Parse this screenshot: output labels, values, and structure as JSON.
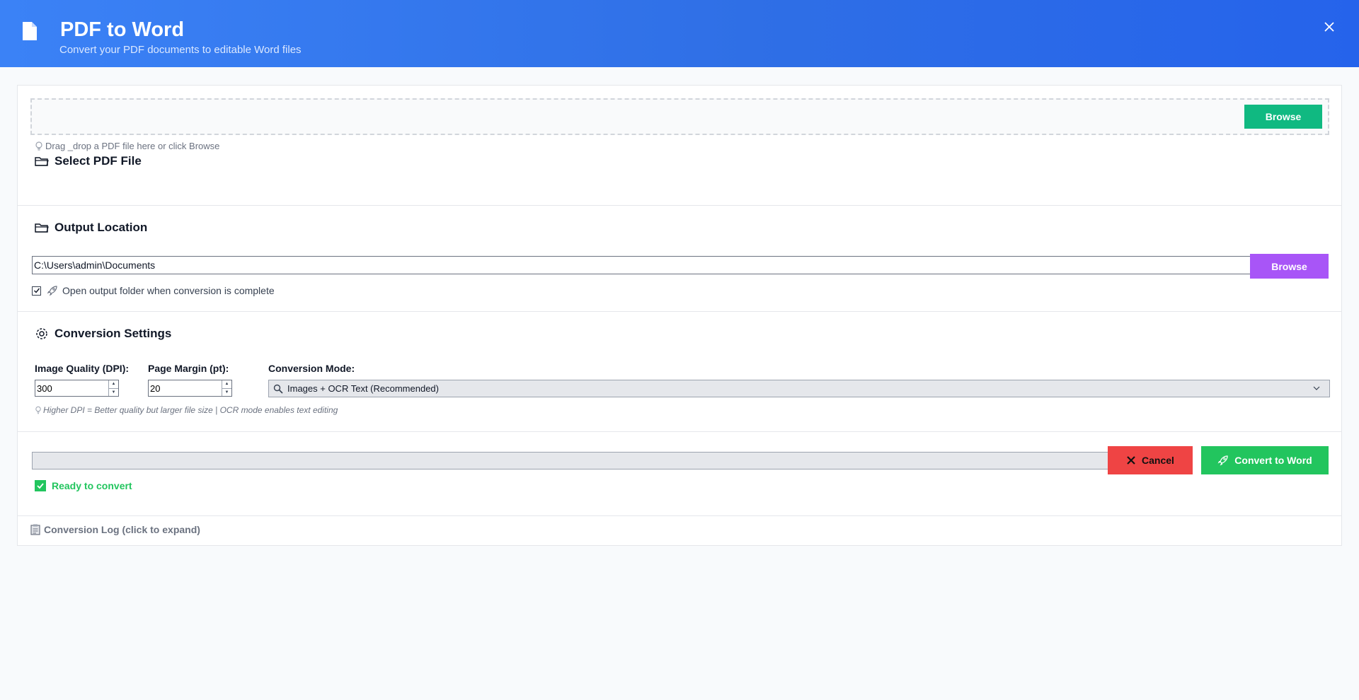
{
  "header": {
    "title": "PDF to Word",
    "subtitle": "Convert your PDF documents to editable Word files",
    "icon": "document-icon",
    "close_icon": "close-icon"
  },
  "select_pdf": {
    "title": "Select PDF File",
    "icon": "folder-icon",
    "hint": "Drag _drop a PDF file here or click Browse",
    "hint_icon": "lightbulb-icon",
    "browse_label": "Browse"
  },
  "output": {
    "title": "Output Location",
    "icon": "folder-icon",
    "path": "C:\\Users\\admin\\Documents",
    "browse_label": "Browse",
    "open_folder_label": "Open output folder when conversion is complete",
    "open_folder_checked": true,
    "open_folder_icon": "rocket-icon"
  },
  "settings": {
    "title": "Conversion Settings",
    "icon": "gear-icon",
    "dpi_label": "Image Quality (DPI):",
    "dpi_value": "300",
    "margin_label": "Page Margin (pt):",
    "margin_value": "20",
    "mode_label": "Conversion Mode:",
    "mode_value": "Images + OCR Text (Recommended)",
    "mode_icon": "magnifier-icon",
    "hint": "Higher DPI = Better quality but larger file size | OCR mode enables text editing"
  },
  "actions": {
    "progress": 0,
    "cancel_label": "Cancel",
    "convert_label": "Convert to Word",
    "status": "Ready to convert"
  },
  "log": {
    "label": "Conversion Log (click to expand)",
    "icon": "clipboard-icon"
  },
  "colors": {
    "header_blue": "#2f6fe6",
    "browse_green": "#10b981",
    "browse_purple": "#a855f7",
    "cancel_red": "#ef4444",
    "convert_green": "#22c55e"
  }
}
